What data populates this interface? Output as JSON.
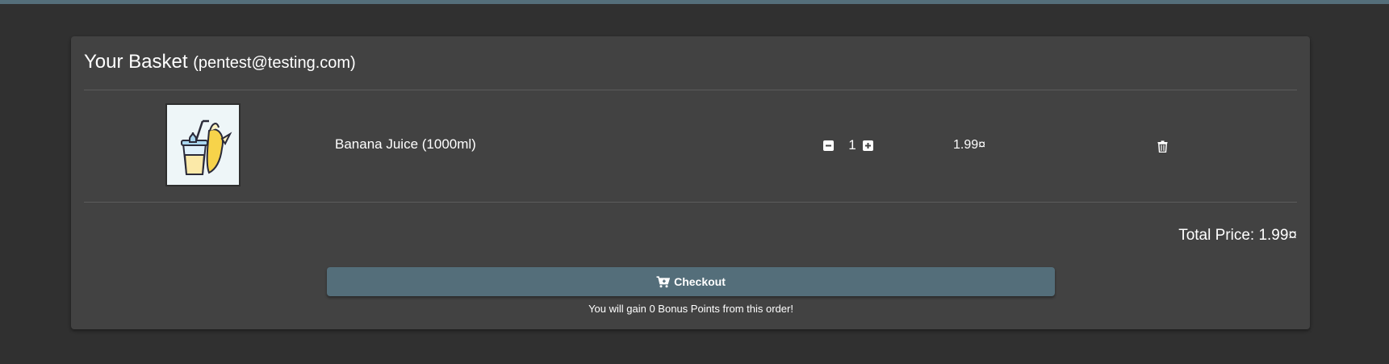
{
  "colors": {
    "accent": "#546e7a",
    "background": "#303030",
    "card": "#424242"
  },
  "basket": {
    "title": "Your Basket",
    "email": "(pentest@testing.com)",
    "items": [
      {
        "image_icon": "banana-juice-icon",
        "name": "Banana Juice (1000ml)",
        "quantity": "1",
        "price": "1.99¤",
        "remove_icon": "trash-icon"
      }
    ],
    "total": "Total Price: 1.99¤",
    "checkout_label": "Checkout",
    "checkout_icon": "cart-icon",
    "bonus_text": "You will gain 0 Bonus Points from this order!"
  }
}
